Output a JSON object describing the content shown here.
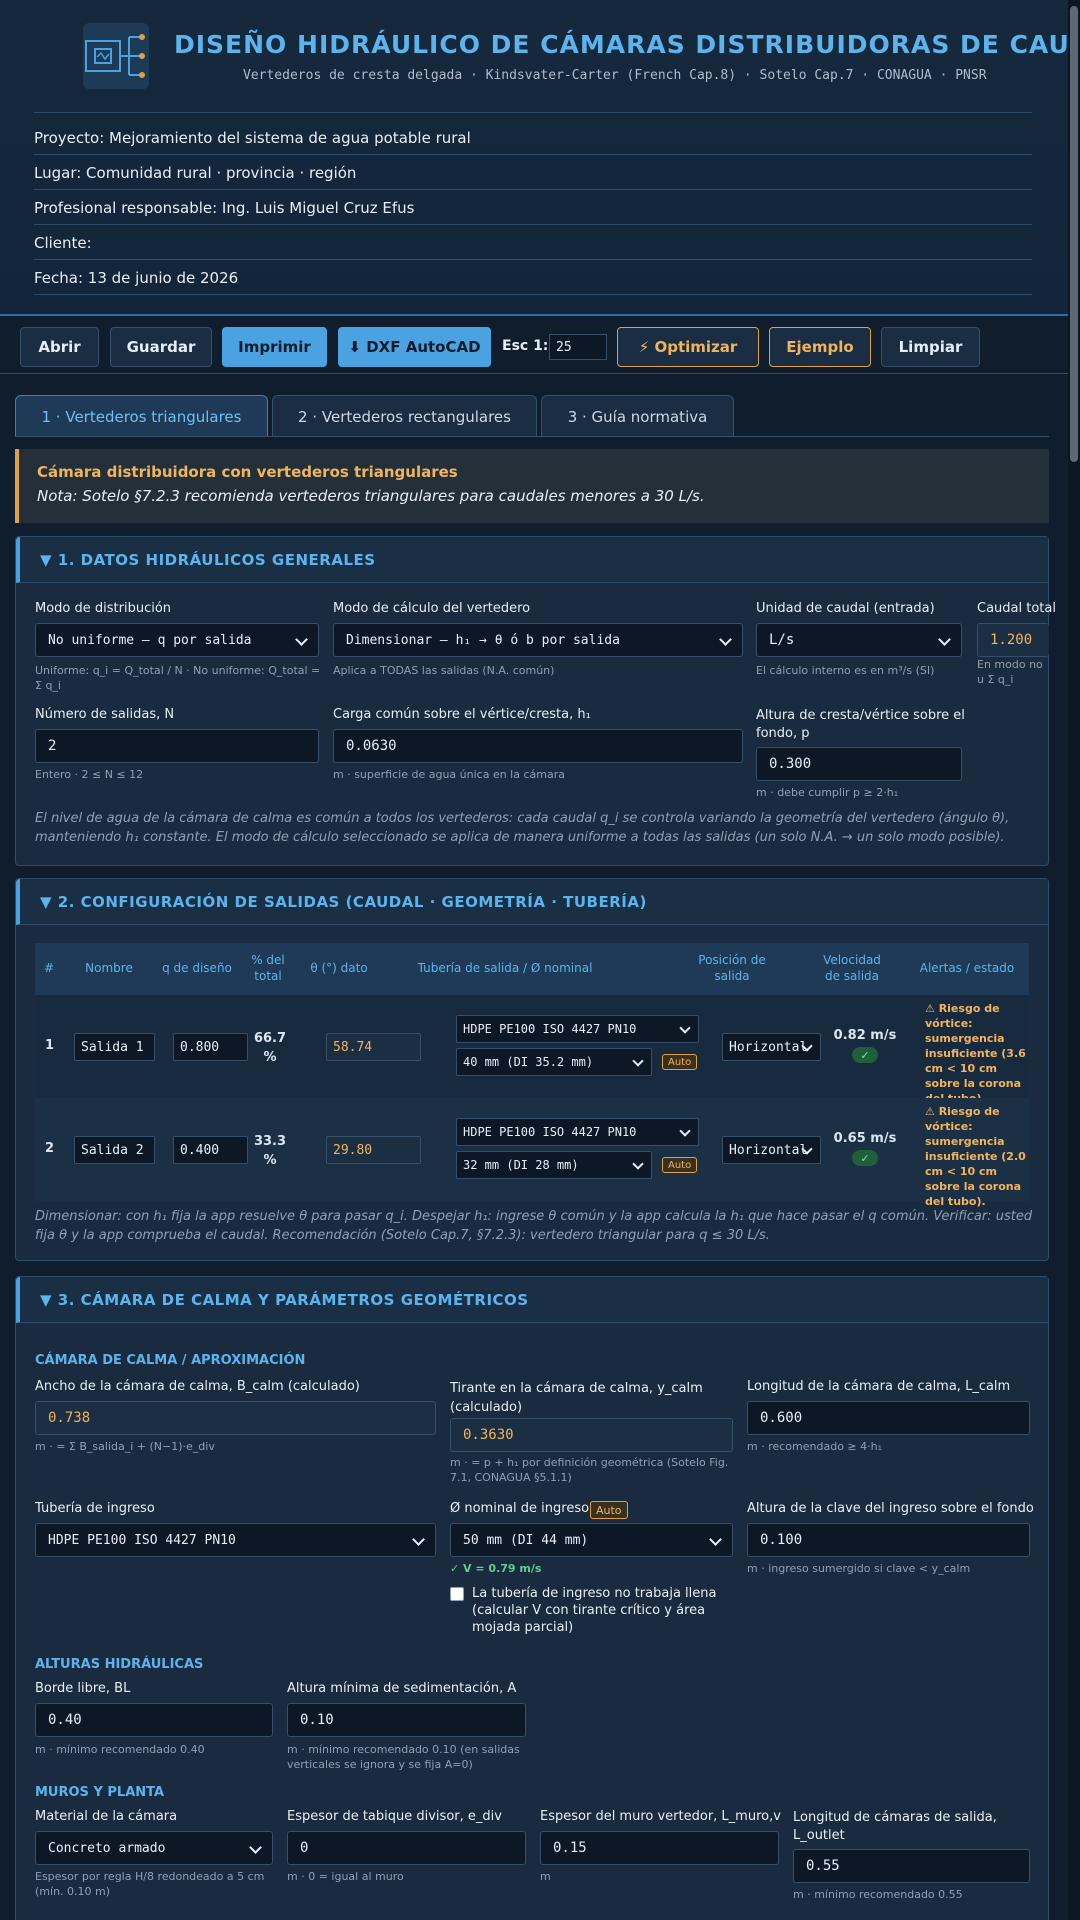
{
  "header": {
    "title": "DISEÑO HIDRÁULICO DE CÁMARAS DISTRIBUIDORAS DE CAUDAL",
    "subtitle": "Vertederos de cresta delgada · Kindsvater-Carter (French Cap.8) · Sotelo Cap.7 · CONAGUA · PNSR",
    "meta": [
      "Proyecto: Mejoramiento del sistema de agua potable rural",
      "Lugar: Comunidad rural · provincia · región",
      "Profesional responsable: Ing. Luis Miguel Cruz Efus",
      "Cliente:",
      "Fecha: 13 de junio de 2026"
    ]
  },
  "toolbar": {
    "open": "Abrir",
    "save": "Guardar",
    "print": "Imprimir",
    "dxf": "⬇ DXF AutoCAD",
    "scale_label": "Esc 1:",
    "scale_value": "25",
    "optimize": "⚡ Optimizar",
    "example": "Ejemplo",
    "clear": "Limpiar"
  },
  "tabs": [
    "1 · Vertederos triangulares",
    "2 · Vertederos rectangulares",
    "3 · Guía normativa"
  ],
  "notice": {
    "title": "Cámara distribuidora con vertederos triangulares",
    "text": "Nota: Sotelo §7.2.3 recomienda vertederos triangulares para caudales menores a 30 L/s."
  },
  "s1": {
    "title": "▼ 1. DATOS HIDRÁULICOS GENERALES",
    "dist_label": "Modo de distribución",
    "dist_value": "No uniforme — q por salida",
    "dist_hint": "Uniforme: q_i = Q_total / N · No uniforme: Q_total = Σ q_i",
    "calc_label": "Modo de cálculo del vertedero",
    "calc_value": "Dimensionar — h₁ → θ ó b por salida",
    "calc_hint": "Aplica a TODAS las salidas (N.A. común)",
    "unit_label": "Unidad de caudal (entrada)",
    "unit_value": "L/s",
    "unit_hint": "El cálculo interno es en m³/s (SI)",
    "qtot_label": "Caudal total",
    "qtot_value": "1.200",
    "qtot_hint": "En modo no u Σ q_i",
    "n_label": "Número de salidas, N",
    "n_value": "2",
    "n_hint": "Entero · 2 ≤ N ≤ 12",
    "h1_label": "Carga común sobre el vértice/cresta, h₁",
    "h1_value": "0.0630",
    "h1_hint": "m · superficie de agua única en la cámara",
    "p_label": "Altura de cresta/vértice sobre el fondo, p",
    "p_value": "0.300",
    "p_hint": "m · debe cumplir p ≥ 2·h₁",
    "note": "El nivel de agua de la cámara de calma es común a todos los vertederos: cada caudal q_i se controla variando la geometría del vertedero (ángulo θ), manteniendo h₁ constante. El modo de cálculo seleccionado se aplica de manera uniforme a todas las salidas (un solo N.A. → un solo modo posible)."
  },
  "s2": {
    "title": "▼ 2. CONFIGURACIÓN DE SALIDAS (CAUDAL · GEOMETRÍA · TUBERÍA)",
    "headers": [
      "#",
      "Nombre",
      "q de diseño",
      "% del total",
      "θ (°) dato",
      "Tubería de salida / Ø nominal",
      "Posición de salida",
      "Velocidad de salida",
      "Alertas / estado"
    ],
    "rows": [
      {
        "n": "1",
        "name": "Salida 1",
        "q": "0.800",
        "pct": "66.7 %",
        "theta": "58.74",
        "pipe": "HDPE PE100 ISO 4427 PN10",
        "dn": "40 mm (DI 35.2 mm)",
        "auto": "Auto",
        "pos": "Horizontal",
        "vel": "0.82 m/s",
        "ok": "✓",
        "alert": "⚠ Riesgo de vórtice: sumergencia insuficiente (3.6 cm < 10 cm sobre la corona del tubo)."
      },
      {
        "n": "2",
        "name": "Salida 2",
        "q": "0.400",
        "pct": "33.3 %",
        "theta": "29.80",
        "pipe": "HDPE PE100 ISO 4427 PN10",
        "dn": "32 mm (DI 28 mm)",
        "auto": "Auto",
        "pos": "Horizontal",
        "vel": "0.65 m/s",
        "ok": "✓",
        "alert": "⚠ Riesgo de vórtice: sumergencia insuficiente (2.0 cm < 10 cm sobre la corona del tubo)."
      }
    ],
    "note": "Dimensionar: con h₁ fija la app resuelve θ para pasar q_i. Despejar h₁: ingrese θ común y la app calcula la h₁ que hace pasar el q común. Verificar: usted fija θ y la app comprueba el caudal. Recomendación (Sotelo Cap.7, §7.2.3): vertedero triangular para q ≤ 30 L/s."
  },
  "s3": {
    "title": "▼ 3. CÁMARA DE CALMA Y PARÁMETROS GEOMÉTRICOS",
    "sec_calm": "CÁMARA DE CALMA / APROXIMACIÓN",
    "bcalm_label": "Ancho de la cámara de calma, B_calm (calculado)",
    "bcalm_value": "0.738",
    "bcalm_hint": "m · = Σ B_salida_i + (N−1)·e_div",
    "ycalm_label": "Tirante en la cámara de calma, y_calm (calculado)",
    "ycalm_value": "0.3630",
    "ycalm_hint": "m · = p + h₁ por definición geométrica (Sotelo Fig. 7.1, CONAGUA §5.1.1)",
    "lcalm_label": "Longitud de la cámara de calma, L_calm",
    "lcalm_value": "0.600",
    "lcalm_hint": "m · recomendado ≥ 4·h₁",
    "inpipe_label": "Tubería de ingreso",
    "inpipe_value": "HDPE PE100 ISO 4427 PN10",
    "indn_label": "Ø nominal de ingreso",
    "indn_auto": "Auto",
    "indn_value": "50 mm (DI 44 mm)",
    "indn_vel": "✓ V = 0.79 m/s",
    "chk_label": "La tubería de ingreso no trabaja llena (calcular V con tirante crítico y área mojada parcial)",
    "clave_label": "Altura de la clave del ingreso sobre el fondo",
    "clave_value": "0.100",
    "clave_hint": "m · ingreso sumergido si clave < y_calm",
    "sec_alt": "ALTURAS HIDRÁULICAS",
    "bl_label": "Borde libre, BL",
    "bl_value": "0.40",
    "bl_hint": "m · mínimo recomendado 0.40",
    "a_label": "Altura mínima de sedimentación, A",
    "a_value": "0.10",
    "a_hint": "m · mínimo recomendado 0.10 (en salidas verticales se ignora y se fija A=0)",
    "sec_muros": "MUROS Y PLANTA",
    "mat_label": "Material de la cámara",
    "mat_value": "Concreto armado",
    "mat_hint": "Espesor por regla H/8 redondeado a 5 cm (mín. 0.10 m)",
    "ediv_label": "Espesor de tabique divisor, e_div",
    "ediv_value": "0",
    "ediv_hint": "m · 0 = igual al muro",
    "emuro_label": "Espesor del muro vertedor, L_muro,v",
    "emuro_value": "0.15",
    "emuro_hint": "m",
    "lout_label": "Longitud de cámaras de salida, L_outlet",
    "lout_value": "0.55",
    "lout_hint": "m · mínimo recomendado 0.55"
  }
}
